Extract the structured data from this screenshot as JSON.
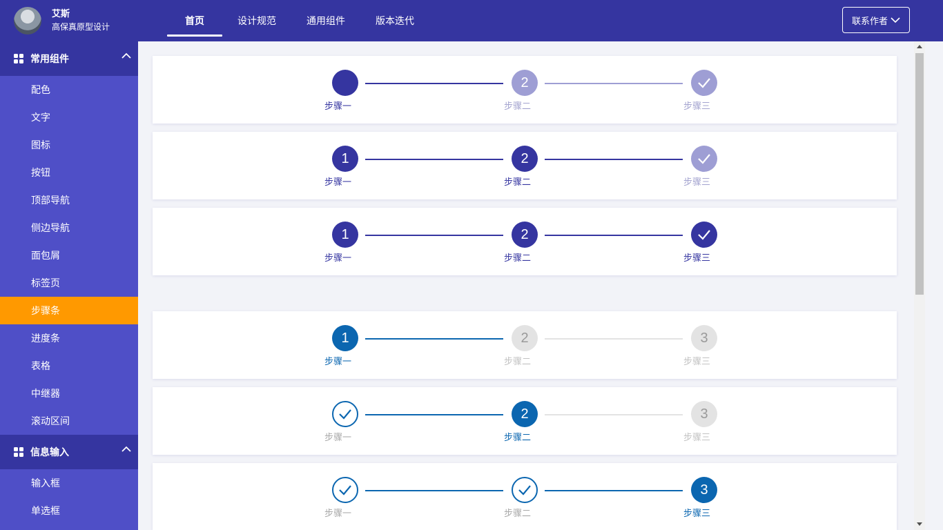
{
  "brand": {
    "name": "艾斯",
    "subtitle": "高保真原型设计"
  },
  "nav": [
    {
      "label": "首页",
      "active": true
    },
    {
      "label": "设计规范"
    },
    {
      "label": "通用组件"
    },
    {
      "label": "版本迭代"
    }
  ],
  "contact": {
    "label": "联系作者"
  },
  "sidebar": {
    "groups": [
      {
        "title": "常用组件",
        "items": [
          "配色",
          "文字",
          "图标",
          "按钮",
          "顶部导航",
          "侧边导航",
          "面包屑",
          "标签页",
          "步骤条",
          "进度条",
          "表格",
          "中继器",
          "滚动区间"
        ]
      },
      {
        "title": "信息输入",
        "items": [
          "输入框",
          "单选框"
        ]
      }
    ],
    "active_item": "步骤条"
  },
  "steps": {
    "labels": [
      "步骤一",
      "步骤二",
      "步骤三"
    ],
    "numbers": [
      "1",
      "2",
      "3"
    ]
  },
  "colors": {
    "header": "#3535a0",
    "sidebar": "#4f4fc7",
    "active": "#ff9900",
    "purple_done": "#3535a0",
    "purple_todo": "#9e9ed4",
    "blue_active": "#0b66b0",
    "grey_todo": "#e3e3e3"
  }
}
